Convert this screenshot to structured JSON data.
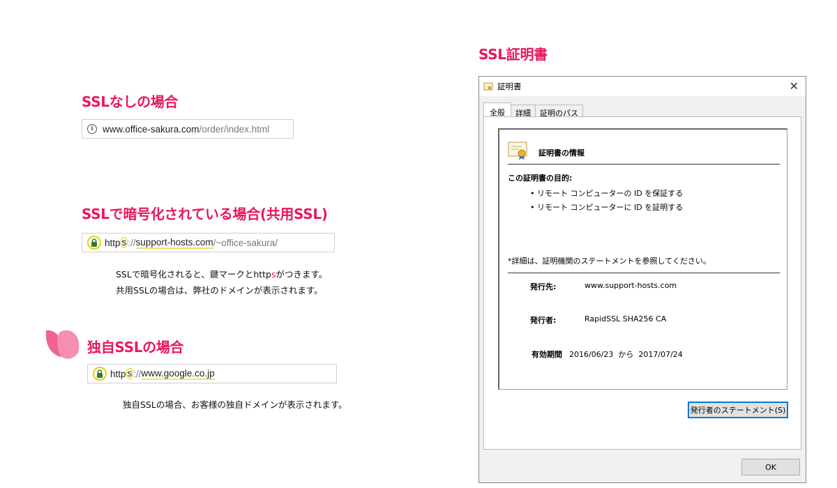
{
  "headings": {
    "cert_title": "SSL証明書",
    "no_ssl": "SSLなしの場合",
    "shared_ssl": "SSLで暗号化されている場合(共用SSL)",
    "own_ssl": "独自SSLの場合"
  },
  "url_no_ssl": {
    "host": "www.office-sakura.com",
    "path": "/order/index.html"
  },
  "url_shared": {
    "scheme_a": "http",
    "scheme_s": "s",
    "sep": "://",
    "host": "support-hosts.com",
    "path": "/~office-sakura/"
  },
  "url_own": {
    "scheme_a": "http",
    "scheme_s": "s",
    "sep": "://",
    "host": "www.google.co.jp"
  },
  "notes": {
    "shared_line1_a": "SSLで暗号化されると、鍵マークとhttp",
    "shared_line1_s": "s",
    "shared_line1_b": "がつきます。",
    "shared_line2": "共用SSLの場合は、弊社のドメインが表示されます。",
    "own_line1": "独自SSLの場合、お客様の独自ドメインが表示されます。"
  },
  "dialog": {
    "title": "証明書",
    "tabs": [
      "全般",
      "詳細",
      "証明のパス"
    ],
    "info_title": "証明書の情報",
    "purpose_label": "この証明書の目的:",
    "purposes": [
      "• リモート コンピューターの ID を保証する",
      "• リモート コンピューターに ID を証明する"
    ],
    "details_note": "*詳細は、証明機関のステートメントを参照してください。",
    "issued_to_label": "発行先:",
    "issued_to": "www.support-hosts.com",
    "issued_by_label": "発行者:",
    "issued_by": "RapidSSL SHA256 CA",
    "validity_label": "有効期間",
    "valid_from": "2016/06/23",
    "valid_sep": "から",
    "valid_to": "2017/07/24",
    "statement_button": "発行者のステートメント(S)",
    "ok_button": "OK"
  },
  "colors": {
    "accent": "#e8185c",
    "highlight": "#e6d200",
    "lock": "#2e7d32"
  }
}
